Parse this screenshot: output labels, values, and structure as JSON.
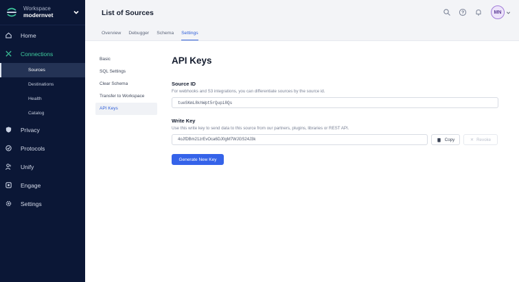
{
  "workspace": {
    "label": "Workspace",
    "name": "modernvet"
  },
  "sidebar": {
    "items": [
      {
        "label": "Home",
        "icon": "home-icon"
      },
      {
        "label": "Connections",
        "icon": "connections-icon"
      },
      {
        "label": "Privacy",
        "icon": "shield-icon"
      },
      {
        "label": "Protocols",
        "icon": "protocols-icon"
      },
      {
        "label": "Unify",
        "icon": "users-icon"
      },
      {
        "label": "Engage",
        "icon": "engage-icon"
      },
      {
        "label": "Settings",
        "icon": "gear-icon"
      }
    ],
    "connections_sub": [
      "Sources",
      "Destinations",
      "Health",
      "Catalog"
    ]
  },
  "header": {
    "title": "List of Sources",
    "avatar_initials": "MN"
  },
  "tabs": [
    "Overview",
    "Debugger",
    "Schema",
    "Settings"
  ],
  "settings_nav": [
    "Basic",
    "SQL Settings",
    "Clear Schema",
    "Transfer to Workspace",
    "API Keys"
  ],
  "main": {
    "title": "API Keys",
    "source_id": {
      "label": "Source ID",
      "help": "For webhooks and S3 integrations, you can differentiate sources by the source id.",
      "value": "tueSKmL8khWpt5rQupi8Qs"
    },
    "write_key": {
      "label": "Write Key",
      "help": "Use this write key to send data to this source from our partners, plugins, libraries or REST API.",
      "value": "4oJfDBm21zrEvOca6DJ0gM7WJGS24J3k",
      "copy_label": "Copy",
      "revoke_label": "Revoke"
    },
    "generate_label": "Generate New Key"
  },
  "colors": {
    "sidebar_bg": "#0b1736",
    "accent": "#3563e9",
    "connections_green": "#3fce9f"
  }
}
